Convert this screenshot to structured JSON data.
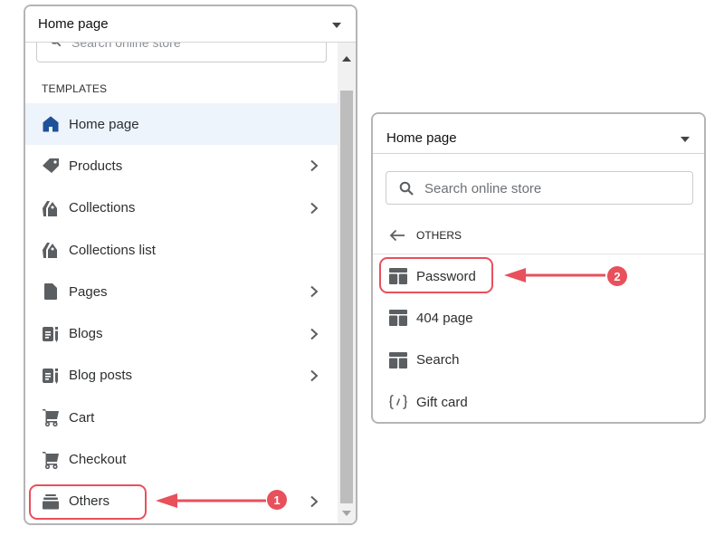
{
  "left_panel": {
    "selector_title": "Home page",
    "search_placeholder": "Search online store",
    "section_label": "TEMPLATES",
    "items": [
      {
        "label": "Home page",
        "icon": "home-icon",
        "has_submenu": false,
        "active": true
      },
      {
        "label": "Products",
        "icon": "tag-icon",
        "has_submenu": true
      },
      {
        "label": "Collections",
        "icon": "collection-tags-icon",
        "has_submenu": true
      },
      {
        "label": "Collections list",
        "icon": "collection-tags-icon",
        "has_submenu": false
      },
      {
        "label": "Pages",
        "icon": "page-icon",
        "has_submenu": true
      },
      {
        "label": "Blogs",
        "icon": "blog-icon",
        "has_submenu": true
      },
      {
        "label": "Blog posts",
        "icon": "blog-icon",
        "has_submenu": true
      },
      {
        "label": "Cart",
        "icon": "cart-icon",
        "has_submenu": false
      },
      {
        "label": "Checkout",
        "icon": "cart-icon",
        "has_submenu": false
      },
      {
        "label": "Others",
        "icon": "archive-icon",
        "has_submenu": true
      }
    ]
  },
  "right_panel": {
    "selector_title": "Home page",
    "search_placeholder": "Search online store",
    "back_label": "OTHERS",
    "items": [
      {
        "label": "Password",
        "icon": "layout-icon"
      },
      {
        "label": "404 page",
        "icon": "layout-icon"
      },
      {
        "label": "Search",
        "icon": "layout-icon"
      },
      {
        "label": "Gift card",
        "icon": "code-icon"
      }
    ]
  },
  "annotations": {
    "step1": "1",
    "step2": "2",
    "color": "#e8505b"
  },
  "colors": {
    "active_bg": "#eef4fc",
    "home_icon": "#1f5199",
    "icon_gray": "#5c5f62"
  }
}
